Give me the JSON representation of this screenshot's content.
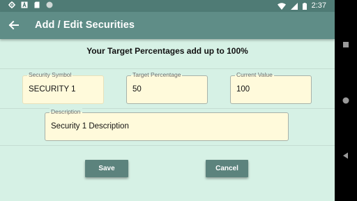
{
  "status_bar": {
    "time": "2:37",
    "left_icons": [
      "gear-icon",
      "a-box-icon",
      "sd-card-icon",
      "circle-icon"
    ],
    "right_icons": [
      "wifi-icon",
      "signal-icon",
      "battery-icon"
    ]
  },
  "app_bar": {
    "title": "Add / Edit Securities",
    "back_icon": "back-arrow-icon"
  },
  "headline": "Your Target Percentages add up to 100%",
  "form": {
    "security_symbol": {
      "label": "Security Symbol",
      "value": "SECURITY 1"
    },
    "target_percentage": {
      "label": "Target Percentage",
      "value": "50"
    },
    "current_value": {
      "label": "Current Value",
      "value": "100"
    },
    "description": {
      "label": "Description",
      "value": "Security 1 Description"
    }
  },
  "buttons": {
    "save": "Save",
    "cancel": "Cancel"
  },
  "nav_bar": {
    "icons": [
      "recents-square-icon",
      "home-circle-icon",
      "back-triangle-icon"
    ]
  },
  "colors": {
    "background": "#d6f1e5",
    "app_bar": "#5f8d87",
    "status_bar": "#4f7b75",
    "field_fill": "#fffadb",
    "button": "#5c837d"
  }
}
